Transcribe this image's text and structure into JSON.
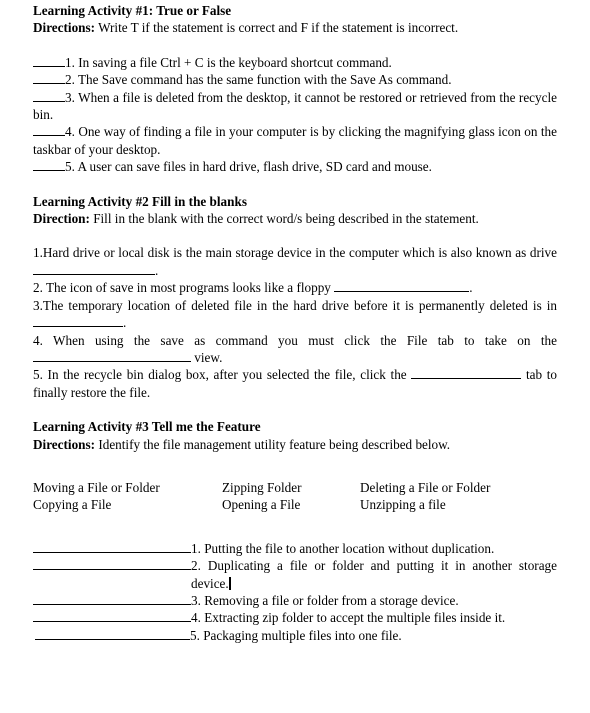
{
  "document": {
    "activity1": {
      "heading": "Learning Activity #1: True or False",
      "directions_label": "Directions:",
      "directions_text": " Write T if the statement is correct and F if the statement is incorrect.",
      "items": [
        {
          "number": "1.",
          "text": " In saving a file Ctrl + C is the keyboard shortcut command."
        },
        {
          "number": "2.",
          "text": " The Save command has the same function with the Save As command."
        },
        {
          "number": "3.",
          "text": " When a file is deleted from the desktop, it cannot be restored or retrieved from the recycle bin."
        },
        {
          "number": "4.",
          "text": " One way of finding a file in your computer is by clicking the magnifying glass icon on the taskbar of your desktop."
        },
        {
          "number": "5.",
          "text": " A user can save files in hard drive, flash drive, SD card and mouse."
        }
      ]
    },
    "activity2": {
      "heading": "Learning Activity #2 Fill in the blanks",
      "directions_label": "Direction:",
      "directions_text": " Fill in the blank with the correct word/s being described in the statement.",
      "items": [
        {
          "prefix": "1.Hard drive or local disk is the main storage device in the computer which is also known as drive ",
          "suffix": "."
        },
        {
          "prefix": "2. The icon of save in most programs looks like a floppy ",
          "suffix": "."
        },
        {
          "prefix": "3.The temporary location of deleted file in the hard drive before it is permanently deleted is in ",
          "suffix": "."
        },
        {
          "prefix": "4. When using the save as command you must click the File tab to take on the ",
          "suffix": " view."
        },
        {
          "prefix": "5. In the recycle bin dialog box, after you selected the file, click the ",
          "suffix": " tab to finally restore the file."
        }
      ]
    },
    "activity3": {
      "heading": "Learning Activity #3 Tell me the Feature",
      "directions_label": "Directions:",
      "directions_text": " Identify the file management utility feature being described below.",
      "word_bank": {
        "row1": {
          "col1": "Moving a File or Folder",
          "col2": "Zipping Folder",
          "col3": "Deleting a File or Folder"
        },
        "row2": {
          "col1": "Copying a File",
          "col2": "Opening a File",
          "col3": "Unzipping a file"
        }
      },
      "items": [
        {
          "number": "1.",
          "text": " Putting the file to another location without duplication."
        },
        {
          "number": "2.",
          "text": " Duplicating a file or folder and putting it in another storage device."
        },
        {
          "number": "3.",
          "text": " Removing a file or folder from a storage device."
        },
        {
          "number": "4.",
          "text": " Extracting zip folder to accept the multiple files inside it."
        },
        {
          "number": "5.",
          "text": " Packaging multiple files into one file."
        }
      ]
    }
  }
}
